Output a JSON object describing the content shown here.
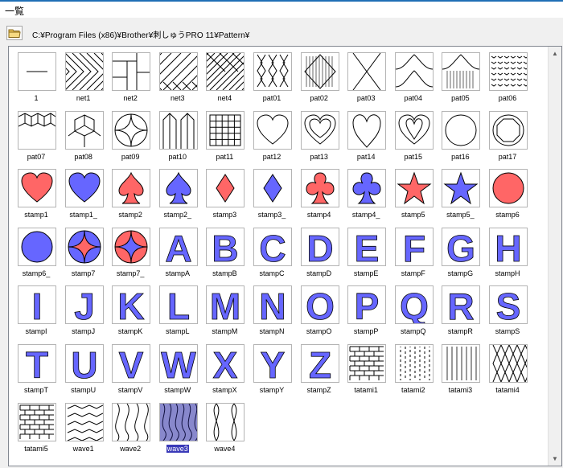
{
  "window": {
    "title": "一覧"
  },
  "pathbar": {
    "folder_icon": "folder-icon",
    "path": "C:¥Program Files (x86)¥Brother¥刺しゅうPRO 11¥Pattern¥"
  },
  "colors": {
    "red": "#ff6666",
    "blue": "#6666ff",
    "selection": "#3a3ab8"
  },
  "selected": "wave3",
  "patterns": [
    {
      "name": "1",
      "kind": "line"
    },
    {
      "name": "net1",
      "kind": "net1"
    },
    {
      "name": "net2",
      "kind": "net2"
    },
    {
      "name": "net3",
      "kind": "net3"
    },
    {
      "name": "net4",
      "kind": "net4"
    },
    {
      "name": "pat01",
      "kind": "pat01"
    },
    {
      "name": "pat02",
      "kind": "pat02"
    },
    {
      "name": "pat03",
      "kind": "pat03"
    },
    {
      "name": "pat04",
      "kind": "pat04"
    },
    {
      "name": "pat05",
      "kind": "pat05"
    },
    {
      "name": "pat06",
      "kind": "pat06"
    },
    {
      "name": "pat07",
      "kind": "pat07"
    },
    {
      "name": "pat08",
      "kind": "pat08"
    },
    {
      "name": "pat09",
      "kind": "pat09"
    },
    {
      "name": "pat10",
      "kind": "pat10"
    },
    {
      "name": "pat11",
      "kind": "pat11"
    },
    {
      "name": "pat12",
      "kind": "heart"
    },
    {
      "name": "pat13",
      "kind": "heart2"
    },
    {
      "name": "pat14",
      "kind": "heart3"
    },
    {
      "name": "pat15",
      "kind": "heart4"
    },
    {
      "name": "pat16",
      "kind": "circle"
    },
    {
      "name": "pat17",
      "kind": "octagon"
    },
    {
      "name": "stamp1",
      "kind": "heart",
      "fill": "red"
    },
    {
      "name": "stamp1_",
      "kind": "heart",
      "fill": "blue"
    },
    {
      "name": "stamp2",
      "kind": "spade",
      "fill": "red"
    },
    {
      "name": "stamp2_",
      "kind": "spade",
      "fill": "blue"
    },
    {
      "name": "stamp3",
      "kind": "diamond",
      "fill": "red"
    },
    {
      "name": "stamp3_",
      "kind": "diamond",
      "fill": "blue"
    },
    {
      "name": "stamp4",
      "kind": "club",
      "fill": "red"
    },
    {
      "name": "stamp4_",
      "kind": "club",
      "fill": "blue"
    },
    {
      "name": "stamp5",
      "kind": "star",
      "fill": "red"
    },
    {
      "name": "stamp5_",
      "kind": "star",
      "fill": "blue"
    },
    {
      "name": "stamp6",
      "kind": "circle",
      "fill": "red"
    },
    {
      "name": "stamp6_",
      "kind": "circle",
      "fill": "blue"
    },
    {
      "name": "stamp7",
      "kind": "astroid",
      "fill": "red",
      "bg": "blue"
    },
    {
      "name": "stamp7_",
      "kind": "astroid",
      "fill": "blue",
      "bg": "red"
    },
    {
      "name": "stampA",
      "kind": "letter",
      "letter": "A"
    },
    {
      "name": "stampB",
      "kind": "letter",
      "letter": "B"
    },
    {
      "name": "stampC",
      "kind": "letter",
      "letter": "C"
    },
    {
      "name": "stampD",
      "kind": "letter",
      "letter": "D"
    },
    {
      "name": "stampE",
      "kind": "letter",
      "letter": "E"
    },
    {
      "name": "stampF",
      "kind": "letter",
      "letter": "F"
    },
    {
      "name": "stampG",
      "kind": "letter",
      "letter": "G"
    },
    {
      "name": "stampH",
      "kind": "letter",
      "letter": "H"
    },
    {
      "name": "stampI",
      "kind": "letter",
      "letter": "I"
    },
    {
      "name": "stampJ",
      "kind": "letter",
      "letter": "J"
    },
    {
      "name": "stampK",
      "kind": "letter",
      "letter": "K"
    },
    {
      "name": "stampL",
      "kind": "letter",
      "letter": "L"
    },
    {
      "name": "stampM",
      "kind": "letter",
      "letter": "M"
    },
    {
      "name": "stampN",
      "kind": "letter",
      "letter": "N"
    },
    {
      "name": "stampO",
      "kind": "letter",
      "letter": "O"
    },
    {
      "name": "stampP",
      "kind": "letter",
      "letter": "P"
    },
    {
      "name": "stampQ",
      "kind": "letter",
      "letter": "Q"
    },
    {
      "name": "stampR",
      "kind": "letter",
      "letter": "R"
    },
    {
      "name": "stampS",
      "kind": "letter",
      "letter": "S"
    },
    {
      "name": "stampT",
      "kind": "letter",
      "letter": "T"
    },
    {
      "name": "stampU",
      "kind": "letter",
      "letter": "U"
    },
    {
      "name": "stampV",
      "kind": "letter",
      "letter": "V"
    },
    {
      "name": "stampW",
      "kind": "letter",
      "letter": "W"
    },
    {
      "name": "stampX",
      "kind": "letter",
      "letter": "X"
    },
    {
      "name": "stampY",
      "kind": "letter",
      "letter": "Y"
    },
    {
      "name": "stampZ",
      "kind": "letter",
      "letter": "Z"
    },
    {
      "name": "tatami1",
      "kind": "brick"
    },
    {
      "name": "tatami2",
      "kind": "dash"
    },
    {
      "name": "tatami3",
      "kind": "vlines"
    },
    {
      "name": "tatami4",
      "kind": "weave"
    },
    {
      "name": "tatami5",
      "kind": "brick"
    },
    {
      "name": "wave1",
      "kind": "zigzag"
    },
    {
      "name": "wave2",
      "kind": "wave"
    },
    {
      "name": "wave3",
      "kind": "wave3"
    },
    {
      "name": "wave4",
      "kind": "wave4"
    }
  ]
}
